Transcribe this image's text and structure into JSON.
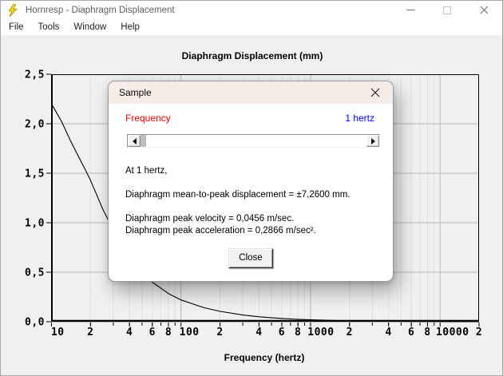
{
  "window": {
    "title": "Hornresp - Diaphragm Displacement",
    "controls": [
      "minimize",
      "maximize",
      "close"
    ]
  },
  "menu": {
    "items": [
      "File",
      "Tools",
      "Window",
      "Help"
    ]
  },
  "chart_data": {
    "type": "line",
    "title": "Diaphragm Displacement (mm)",
    "xlabel": "Frequency (hertz)",
    "ylabel": "",
    "x_scale": "log",
    "xlim": [
      10,
      20000
    ],
    "ylim": [
      0,
      2.5
    ],
    "grid": true,
    "x_ticks": [
      {
        "value": 10,
        "label": "10"
      },
      {
        "value": 20,
        "label": "2"
      },
      {
        "value": 40,
        "label": "4"
      },
      {
        "value": 60,
        "label": "6"
      },
      {
        "value": 80,
        "label": "8"
      },
      {
        "value": 100,
        "label": "100"
      },
      {
        "value": 200,
        "label": "2"
      },
      {
        "value": 400,
        "label": "4"
      },
      {
        "value": 600,
        "label": "6"
      },
      {
        "value": 800,
        "label": "8"
      },
      {
        "value": 1000,
        "label": "1000"
      },
      {
        "value": 2000,
        "label": "2"
      },
      {
        "value": 4000,
        "label": "4"
      },
      {
        "value": 6000,
        "label": "6"
      },
      {
        "value": 8000,
        "label": "8"
      },
      {
        "value": 10000,
        "label": "10000"
      },
      {
        "value": 20000,
        "label": "2"
      }
    ],
    "x_minor_per_decade": [
      2,
      3,
      4,
      5,
      6,
      7,
      8,
      9
    ],
    "y_ticks": [
      {
        "value": 0.0,
        "label": "0,0"
      },
      {
        "value": 0.5,
        "label": "0,5"
      },
      {
        "value": 1.0,
        "label": "1,0"
      },
      {
        "value": 1.5,
        "label": "1,5"
      },
      {
        "value": 2.0,
        "label": "2,0"
      },
      {
        "value": 2.5,
        "label": "2,5"
      }
    ],
    "series": [
      {
        "name": "Diaphragm displacement",
        "points": [
          [
            10,
            2.2
          ],
          [
            12,
            2.02
          ],
          [
            14,
            1.83
          ],
          [
            16,
            1.68
          ],
          [
            18,
            1.55
          ],
          [
            20,
            1.43
          ],
          [
            25,
            1.13
          ],
          [
            30,
            0.93
          ],
          [
            35,
            0.78
          ],
          [
            40,
            0.66
          ],
          [
            50,
            0.5
          ],
          [
            60,
            0.4
          ],
          [
            80,
            0.285
          ],
          [
            100,
            0.22
          ],
          [
            150,
            0.142
          ],
          [
            200,
            0.105
          ],
          [
            300,
            0.068
          ],
          [
            400,
            0.05
          ],
          [
            600,
            0.033
          ],
          [
            800,
            0.024
          ],
          [
            1000,
            0.019
          ],
          [
            2000,
            0.009
          ],
          [
            4000,
            0.0045
          ],
          [
            8000,
            0.002
          ],
          [
            20000,
            0.001
          ]
        ]
      }
    ]
  },
  "dialog": {
    "title": "Sample",
    "frequency_label": "Frequency",
    "frequency_value": "1 hertz",
    "line_at": "At 1 hertz,",
    "line_displacement": "Diaphragm mean-to-peak displacement = ±7,2600 mm.",
    "line_velocity": "Diaphragm peak velocity = 0,0456 m/sec.",
    "line_acceleration": "Diaphragm peak acceleration = 0,2866 m/sec².",
    "close_button": "Close"
  },
  "colors": {
    "frequency_label": "#f00000",
    "frequency_value": "#0000ff",
    "curve": "#000000",
    "grid_major": "#b9b9b9",
    "grid_minor": "#dfdfdf",
    "app_icon_yellow": "#ffd800"
  }
}
